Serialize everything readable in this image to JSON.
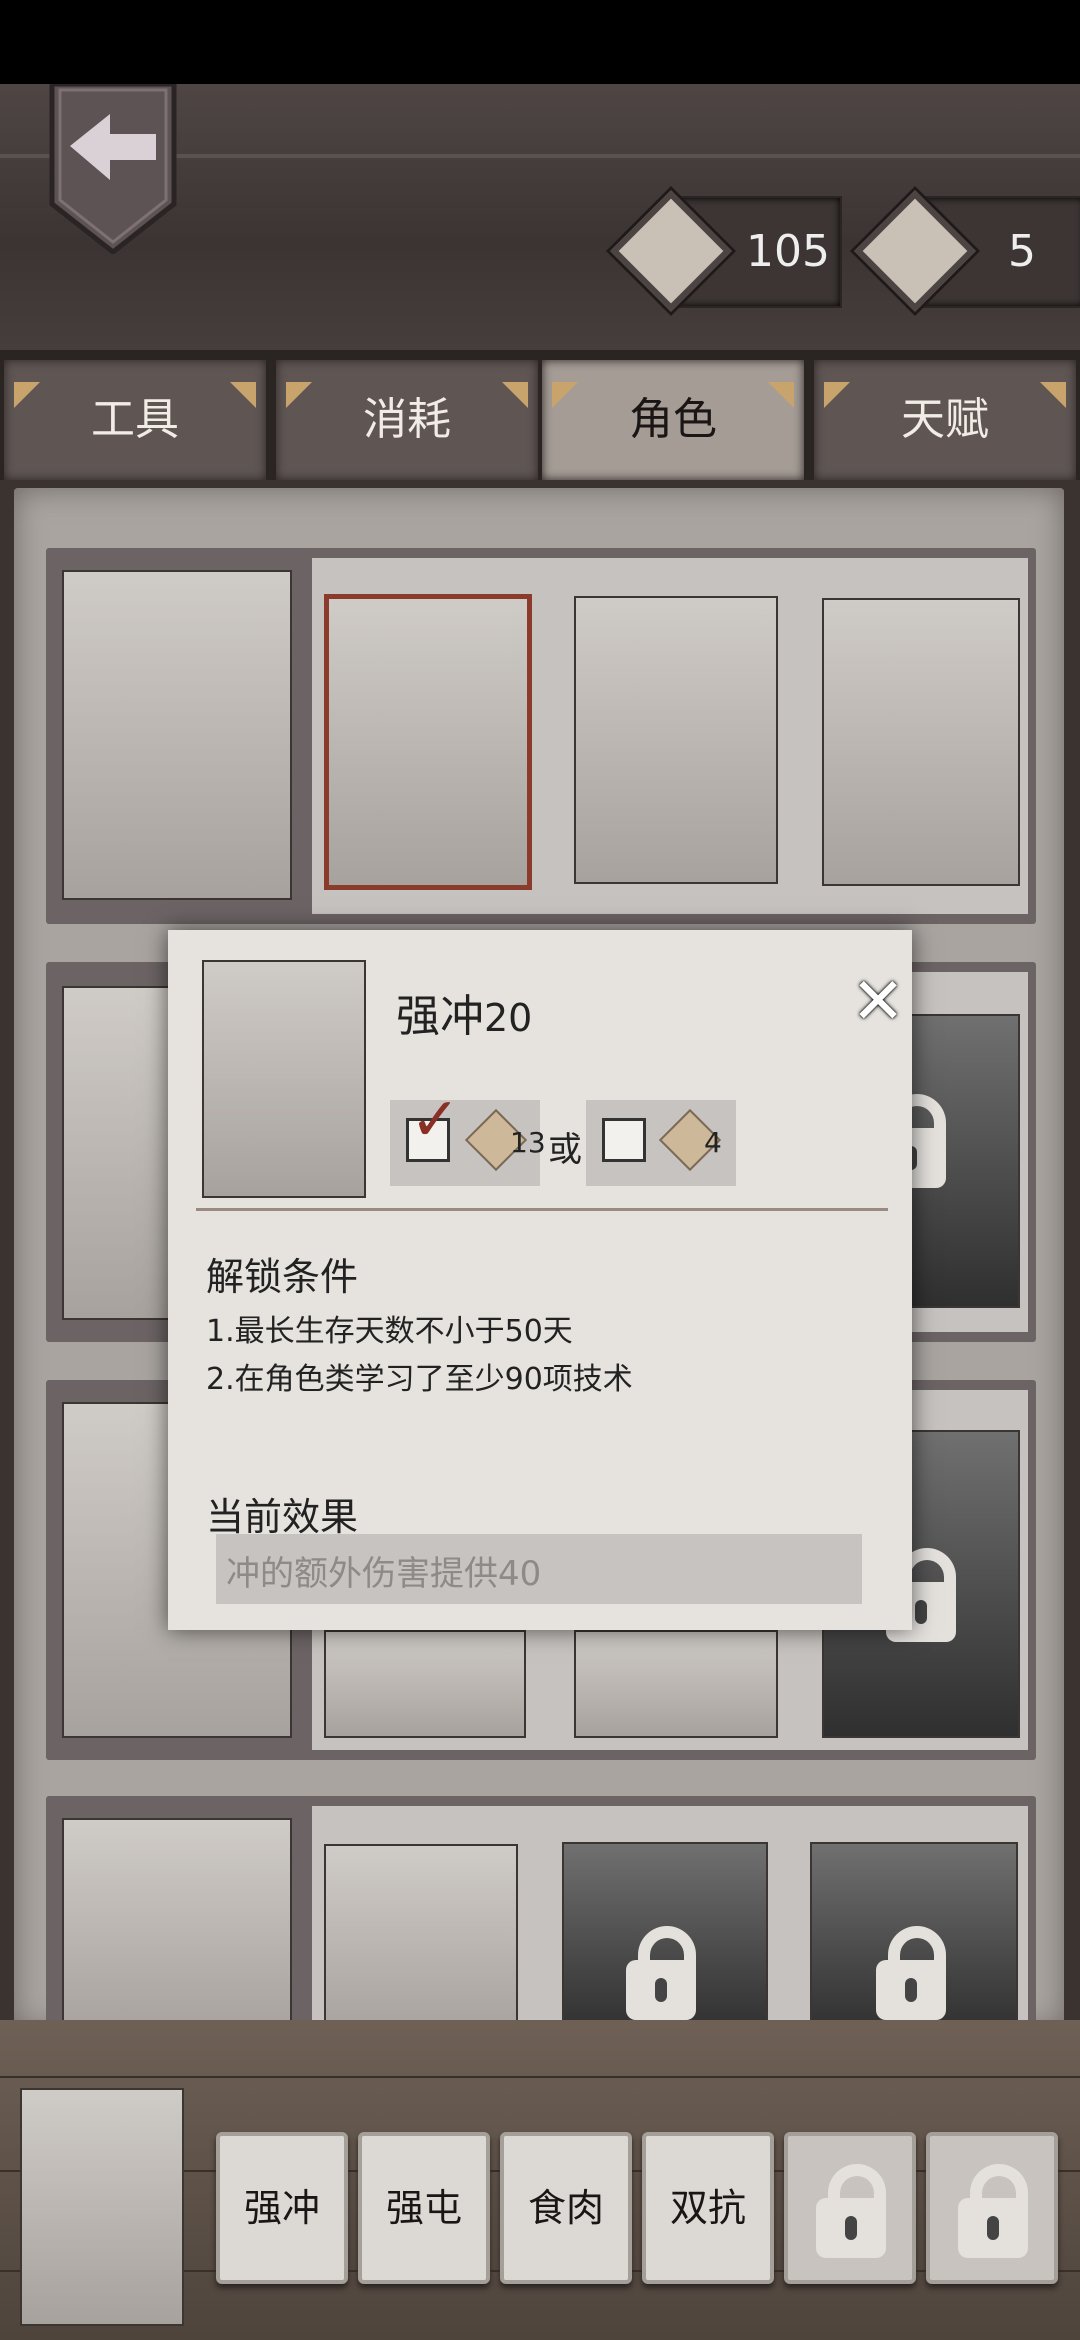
{
  "currency": [
    {
      "icon": "card-icon",
      "value": "105"
    },
    {
      "icon": "card-stack-icon",
      "value": "5"
    }
  ],
  "tabs": [
    {
      "label": "工具",
      "active": false
    },
    {
      "label": "消耗",
      "active": false
    },
    {
      "label": "角色",
      "active": true
    },
    {
      "label": "天赋",
      "active": false
    }
  ],
  "popup": {
    "title": "强冲",
    "level": "20",
    "cost_options": [
      {
        "checked": true,
        "icon": "card-icon",
        "amount": "13"
      },
      {
        "checked": false,
        "icon": "card-stack-icon",
        "amount": "4"
      }
    ],
    "or_label": "或",
    "unlock_heading": "解锁条件",
    "conditions": [
      "1.最长生存天数不小于50天",
      "2.在角色类学习了至少90项技术"
    ],
    "effect_heading": "当前效果",
    "effect_text": "冲的额外伤害提供40"
  },
  "skills": [
    {
      "label": "强冲",
      "locked": false
    },
    {
      "label": "强屯",
      "locked": false
    },
    {
      "label": "食肉",
      "locked": false
    },
    {
      "label": "双抗",
      "locked": false
    },
    {
      "label": "",
      "locked": true
    },
    {
      "label": "",
      "locked": true
    }
  ],
  "colors": {
    "selected_border": "#8a3b2b",
    "active_tab": "#a59c96",
    "check": "#8a2f25"
  }
}
